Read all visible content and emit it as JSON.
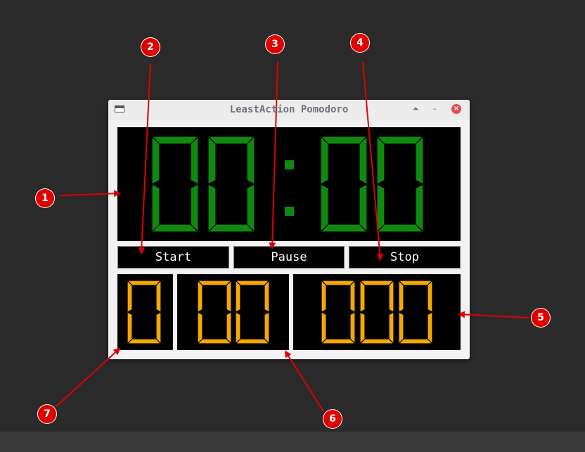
{
  "window": {
    "title": "LeastAction Pomodoro"
  },
  "main_timer": {
    "minutes": "00",
    "seconds": "00",
    "separator": ":",
    "digit_color": "#0f8a0f",
    "background": "#000000"
  },
  "controls": {
    "start_label": "Start",
    "pause_label": "Pause",
    "stop_label": "Stop"
  },
  "sub_counters": {
    "color": "#f5a800",
    "left": "0",
    "middle": "00",
    "right": "000"
  },
  "annotations": [
    "1",
    "2",
    "3",
    "4",
    "5",
    "6",
    "7"
  ],
  "colors": {
    "desktop": "#2b2b2b",
    "annotation": "#e00000",
    "close_button": "#e84c4c"
  },
  "icons": [
    "window-icon",
    "maximize-icon",
    "minimize-icon",
    "close-icon"
  ]
}
